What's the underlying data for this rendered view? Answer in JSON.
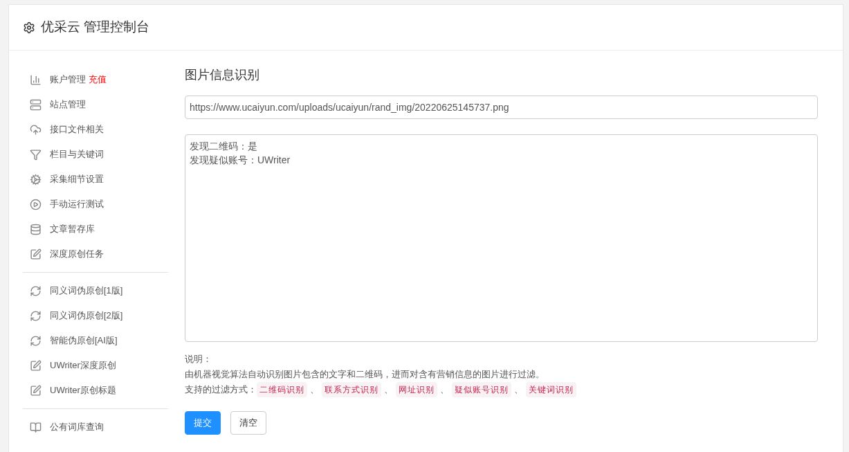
{
  "header": {
    "title": "优采云 管理控制台"
  },
  "sidebar": {
    "groups": [
      {
        "items": [
          {
            "label": "账户管理",
            "badge": "充值"
          },
          {
            "label": "站点管理"
          },
          {
            "label": "接口文件相关"
          },
          {
            "label": "栏目与关键词"
          },
          {
            "label": "采集细节设置"
          },
          {
            "label": "手动运行测试"
          },
          {
            "label": "文章暂存库"
          },
          {
            "label": "深度原创任务"
          }
        ]
      },
      {
        "items": [
          {
            "label": "同义词伪原创[1版]"
          },
          {
            "label": "同义词伪原创[2版]"
          },
          {
            "label": "智能伪原创[AI版]"
          },
          {
            "label": "UWriter深度原创"
          },
          {
            "label": "UWriter原创标题"
          }
        ]
      },
      {
        "items": [
          {
            "label": "公有词库查询"
          }
        ]
      }
    ]
  },
  "main": {
    "title": "图片信息识别",
    "url_field": {
      "value": "https://www.ucaiyun.com/uploads/ucaiyun/rand_img/20220625145737.png"
    },
    "result_box": {
      "lines": [
        "发现二维码：是",
        "发现疑似账号：UWriter"
      ]
    },
    "notes": {
      "heading": "说明：",
      "description": "由机器视觉算法自动识别图片包含的文字和二维码，进而对含有营销信息的图片进行过滤。",
      "methods_label": "支持的过滤方式：",
      "separator": "、",
      "methods": [
        "二维码识别",
        "联系方式识别",
        "网址识别",
        "疑似账号识别",
        "关键词识别"
      ]
    },
    "buttons": [
      {
        "label": "提交",
        "kind": "primary"
      },
      {
        "label": "清空",
        "kind": "default"
      }
    ]
  }
}
